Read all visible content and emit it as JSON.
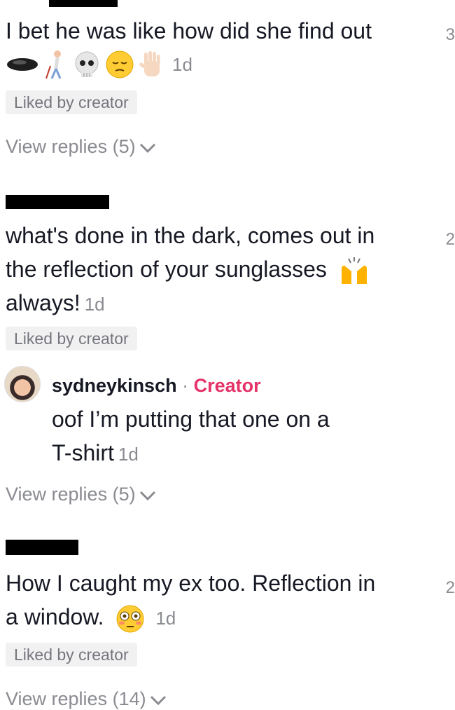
{
  "comments": [
    {
      "text": "I bet he was like how did she find out",
      "emojis": [
        "black-oval",
        "person-with-cane",
        "skull",
        "pensive-face",
        "raised-hand"
      ],
      "time": "1d",
      "like_count": "3",
      "badge": "Liked by creator",
      "view_replies": "View replies (5)"
    },
    {
      "text_lines": [
        "what's done in the dark, comes out in",
        "the reflection of your sunglasses"
      ],
      "text_last": "always!",
      "emoji": "raising-hands",
      "time": "1d",
      "like_count": "2",
      "badge": "Liked by creator",
      "reply": {
        "username": "sydneykinsch",
        "separator": "·",
        "creator_label": "Creator",
        "text": "oof I’m putting that one on a",
        "text_last": "T-shirt",
        "time": "1d"
      },
      "view_replies": "View replies (5)"
    },
    {
      "text": "How I caught my ex too. Reflection in",
      "text_last": "a window.",
      "emoji": "flushed-face",
      "time": "1d",
      "like_count": "2",
      "badge": "Liked by creator",
      "view_replies": "View replies (14)"
    }
  ],
  "colors": {
    "creator": "#e5336a",
    "muted": "#8a8b91",
    "badge_bg": "#f1f1f2"
  }
}
